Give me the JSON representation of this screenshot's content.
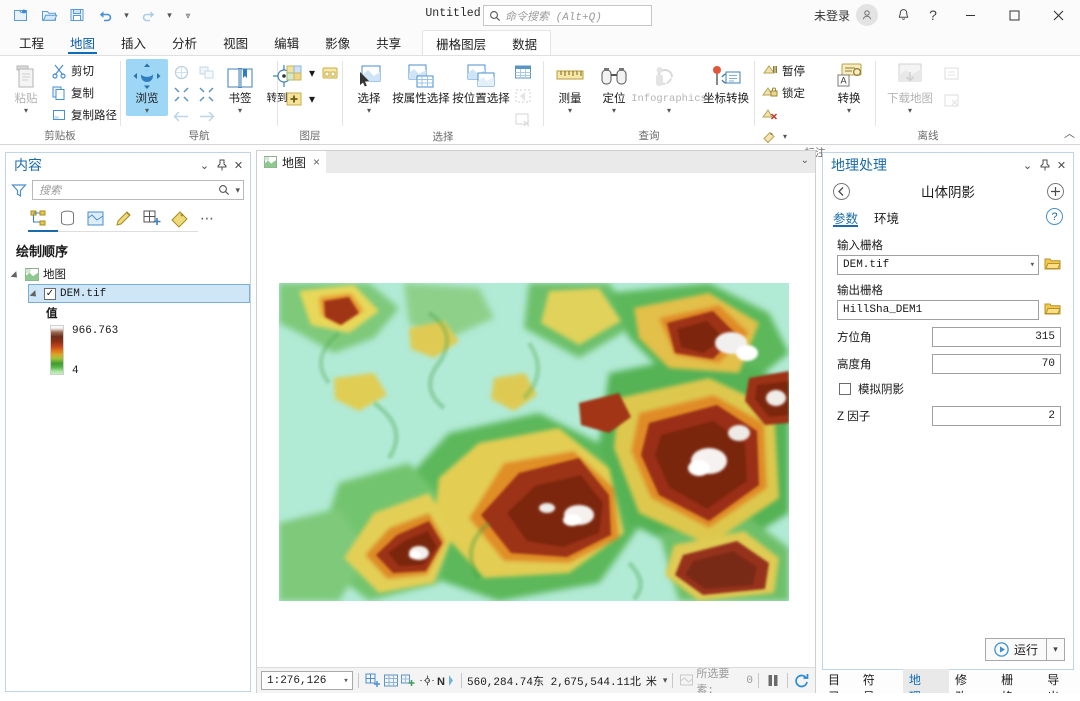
{
  "titlebar": {
    "project_title": "Untitled",
    "search_placeholder": "命令搜索 (Alt+Q)",
    "sign_in": "未登录",
    "quick_access": [
      "new-project-icon",
      "open-project-icon",
      "save-project-icon",
      "undo-icon",
      "redo-icon",
      "customize-qat-icon"
    ],
    "window_buttons": [
      "minimize",
      "maximize",
      "close"
    ],
    "help_icon": "?",
    "notification_icon": "bell-icon"
  },
  "ribbon": {
    "tabs": [
      {
        "label": "工程",
        "active": false
      },
      {
        "label": "地图",
        "active": true
      },
      {
        "label": "插入",
        "active": false
      },
      {
        "label": "分析",
        "active": false
      },
      {
        "label": "视图",
        "active": false
      },
      {
        "label": "编辑",
        "active": false
      },
      {
        "label": "影像",
        "active": false
      },
      {
        "label": "共享",
        "active": false
      }
    ],
    "contextual_tabs": [
      {
        "label": "栅格图层",
        "active": false
      },
      {
        "label": "数据",
        "active": false
      }
    ],
    "groups": [
      {
        "label": "剪贴板",
        "big": [
          {
            "label": "粘贴",
            "icon": "paste-icon",
            "caret": true,
            "disabled": true
          }
        ],
        "small": [
          {
            "label": "剪切",
            "icon": "cut-icon"
          },
          {
            "label": "复制",
            "icon": "copy-icon"
          },
          {
            "label": "复制路径",
            "icon": "copy-path-icon"
          }
        ]
      },
      {
        "label": "导航",
        "big": [
          {
            "label": "浏览",
            "icon": "explore-navigate-icon",
            "caret": true,
            "selected": true
          },
          {
            "label": "书签",
            "icon": "bookmarks-icon",
            "caret": true
          },
          {
            "label": "转到XY",
            "icon": "go-to-xy-icon",
            "caret": false
          }
        ],
        "mini": [
          "full-extent-icon",
          "previous-next-extent-icon",
          "fixed-zoom-in-icon",
          "fixed-zoom-out-icon",
          "back-extent-icon",
          "forward-extent-icon"
        ]
      },
      {
        "label": "图层",
        "small": [
          {
            "label": "",
            "icon": "basemap-icon",
            "caret": true
          },
          {
            "label": "",
            "icon": "add-data-icon",
            "caret": true
          },
          {
            "label": "",
            "icon": "add-preset-icon",
            "caret": false
          }
        ]
      },
      {
        "label": "选择",
        "big": [
          {
            "label": "选择",
            "icon": "select-icon",
            "caret": true
          },
          {
            "label": "按属性选择",
            "icon": "select-by-attribute-icon",
            "caret": false
          },
          {
            "label": "按位置选择",
            "icon": "select-by-location-icon",
            "caret": false
          }
        ],
        "mini": [
          "attribute-table-icon",
          "select-all-icon",
          "clear-selection-icon"
        ]
      },
      {
        "label": "查询",
        "big": [
          {
            "label": "测量",
            "icon": "measure-icon",
            "caret": true
          },
          {
            "label": "定位",
            "icon": "locate-icon",
            "caret": true
          },
          {
            "label": "Infographics",
            "icon": "infographics-icon",
            "caret": true,
            "disabled": true
          },
          {
            "label": "坐标转换",
            "icon": "coordinate-conversion-icon",
            "caret": false
          }
        ]
      },
      {
        "label": "标注",
        "small": [
          {
            "label": "暂停",
            "icon": "pause-labeling-icon"
          },
          {
            "label": "锁定",
            "icon": "lock-labeling-icon"
          },
          {
            "label": "",
            "icon": "remove-labels-icon"
          },
          {
            "label": "",
            "icon": "label-settings-icon",
            "caret": true
          }
        ],
        "big": [
          {
            "label": "转换",
            "icon": "convert-labels-icon",
            "caret": true
          }
        ]
      },
      {
        "label": "离线",
        "big": [
          {
            "label": "下载地图",
            "icon": "download-map-icon",
            "caret": true,
            "disabled": true
          }
        ],
        "mini": [
          "sync-icon",
          "remove-offline-icon"
        ]
      }
    ]
  },
  "contents_panel": {
    "title": "内容",
    "search_placeholder": "搜索",
    "tools": [
      "list-by-drawing-order-icon",
      "list-by-data-source-icon",
      "list-by-selection-icon",
      "list-by-editing-icon",
      "list-by-snapping-icon",
      "list-by-labeling-icon",
      "more-options-icon"
    ],
    "heading": "绘制顺序",
    "tree": [
      {
        "level": 1,
        "label": "地图",
        "icon": "map-icon",
        "expanded": true
      },
      {
        "level": 2,
        "label": "DEM.tif",
        "icon": "raster-layer-icon",
        "checked": true,
        "selected": true,
        "expanded": true
      },
      {
        "level": 3,
        "label": "值",
        "icon": "none"
      }
    ],
    "legend": {
      "max": "966.763",
      "min": "4"
    }
  },
  "map_view": {
    "tab_label": "地图",
    "tab_icon": "map-icon",
    "close_icon": "×",
    "layer_name": "DEM.tif"
  },
  "status_bar": {
    "scale": "1:276,126",
    "coordinates": "560,284.74东  2,675,544.11北",
    "unit": "米",
    "selected_features_label": "所选要素:",
    "selected_features_count": "0",
    "icons": [
      "add-grid-icon",
      "grid-icon",
      "snapping-icon",
      "measure-crosshair-icon",
      "north-arrow-icon",
      "selection-icon",
      "pause-drawing-icon",
      "refresh-icon"
    ]
  },
  "geoprocessing_panel": {
    "title": "地理处理",
    "back_icon": "back-arrow-icon",
    "add_icon": "plus-icon",
    "tool_name": "山体阴影",
    "tabs": [
      {
        "label": "参数",
        "active": true
      },
      {
        "label": "环境",
        "active": false
      }
    ],
    "help_icon": "?",
    "fields": [
      {
        "label": "输入栅格",
        "value": "DEM.tif",
        "type": "combo-browse"
      },
      {
        "label": "输出栅格",
        "value": "HillSha_DEM1",
        "type": "text-browse"
      },
      {
        "label": "方位角",
        "value": "315",
        "type": "number"
      },
      {
        "label": "高度角",
        "value": "70",
        "type": "number"
      },
      {
        "label": "模拟阴影",
        "value": "",
        "type": "checkbox",
        "checked": false
      },
      {
        "label": "Z 因子",
        "value": "2",
        "type": "number"
      }
    ],
    "run_button": "运行"
  },
  "dock_tabs": [
    {
      "label": "目录",
      "active": false
    },
    {
      "label": "符号…",
      "active": false
    },
    {
      "label": "地理…",
      "active": true
    },
    {
      "label": "修改…",
      "active": false
    },
    {
      "label": "栅格…",
      "active": false
    },
    {
      "label": "导出",
      "active": false
    }
  ],
  "colors": {
    "accent": "#1a6ba8",
    "ribbon_selected": "#9ed6f5",
    "tree_selected": "#cfe6f7",
    "panel_border": "#bfd4e4"
  }
}
